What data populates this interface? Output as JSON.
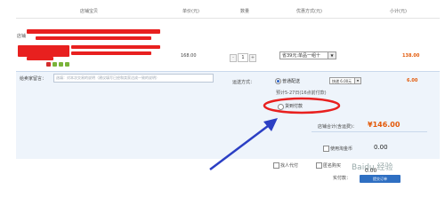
{
  "header": {
    "columns": [
      "店铺宝贝",
      "单价(元)",
      "数量",
      "优惠方式(元)",
      "小计(元)"
    ]
  },
  "shop": {
    "label": "店铺"
  },
  "item": {
    "unit_price": "168.00",
    "quantity": "1",
    "minus": "-",
    "plus": "+",
    "discount_selected": "省39元:单品一组十",
    "subtotal": "138.00"
  },
  "buyer_memo": {
    "label": "给卖家留言：",
    "placeholder": "选填：对本次交易的说明（建议填写已经和卖家达成一致的说明）"
  },
  "shipping": {
    "label": "运送方式：",
    "normal_label": "普通配送",
    "fee_select": "快递 6.00元",
    "fee_amount": "6.00",
    "note": "预计5-27日(16点前付款)",
    "cod_label": "货到付款"
  },
  "shop_total": {
    "label": "店铺合计(含运费)：",
    "value": "¥146.00"
  },
  "options": {
    "coins_label": "使用淘金币",
    "coins_value": "0.00",
    "proxy_label": "找人代付",
    "anon_label": "匿名购买",
    "real_pay_label": "实付款：",
    "real_pay_value": "0.00",
    "submit_label": "提交订单"
  },
  "watermark": "Baidu 经验",
  "colors": {
    "accent_red": "#e8201f",
    "annotation_blue": "#2b3fc4",
    "price_orange": "#e35a0a"
  }
}
